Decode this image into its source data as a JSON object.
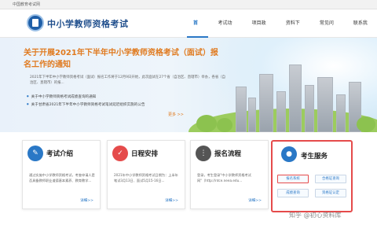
{
  "topbar": {
    "text": "中国教育考试网"
  },
  "header": {
    "site_title": "中小学教师资格考试",
    "nav": [
      {
        "label": "首页"
      },
      {
        "label": "考试动态"
      },
      {
        "label": "项目政策"
      },
      {
        "label": "资料下载"
      },
      {
        "label": "常见问题"
      },
      {
        "label": "联系我们"
      }
    ]
  },
  "hero": {
    "headline": "关于开展2021年下半年中小学教师资格考试（面试）报名工作的通知",
    "summary": "2021年下半年中小学教师资格考试（面试）报名工作将于12月9日开始，此次面试在27个省（自治区、直辖市）举办，各省（自治区、直辖市）的报...",
    "links": [
      "关于中小学教师资格考试成绩查询的通知",
      "关于甘肃省2021年下半年中小学教师资格考试笔试延迟组织实施的公告"
    ],
    "more": "更多 >>"
  },
  "cards": [
    {
      "title": "考试介绍",
      "icon": "edit-icon",
      "color": "#2a78c6",
      "body": "通过实施中小学教师资格考试，考查申请人是否具备教师职业道德基本素养、教育教学...",
      "more": "详细>>"
    },
    {
      "title": "日程安排",
      "icon": "check-icon",
      "color": "#e54b4b",
      "body": "2021年中小学教师资格考试日期为：上半年笔试3月13日、面试5月15-16日...",
      "more": "详细>>"
    },
    {
      "title": "报名流程",
      "icon": "flow-icon",
      "color": "#555555",
      "body": "登录，考生登录\"中小学教师资格考试网\"（http://ntce.neea.edu...",
      "more": "详细>>"
    }
  ],
  "service": {
    "title": "考生服务",
    "buttons": [
      {
        "label": "报名系统"
      },
      {
        "label": "合格证查询"
      },
      {
        "label": "成绩查询"
      },
      {
        "label": "资格证认定"
      }
    ]
  },
  "watermark": "知乎 @初心资料库",
  "colors": {
    "accent": "#2a78c6",
    "orange": "#e07a1f",
    "highlight": "#e54b4b"
  }
}
